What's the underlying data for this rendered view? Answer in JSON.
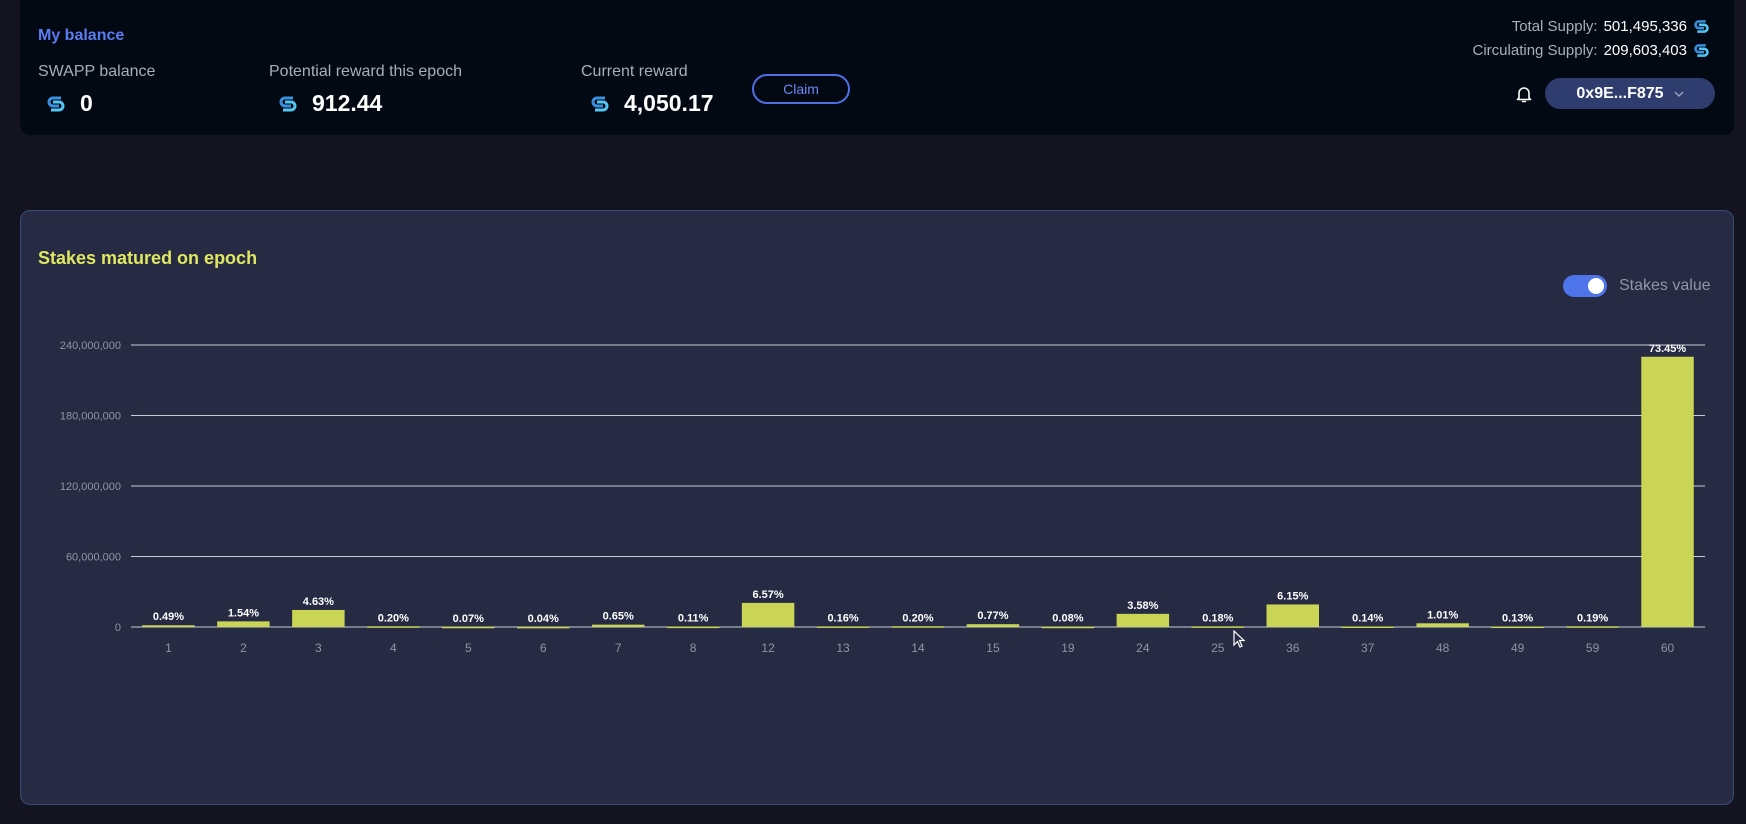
{
  "header": {
    "my_balance": "My balance",
    "swapp_balance": {
      "label": "SWAPP balance",
      "value": "0"
    },
    "potential_reward": {
      "label": "Potential reward this epoch",
      "value": "912.44"
    },
    "current_reward": {
      "label": "Current reward",
      "value": "4,050.17"
    },
    "claim_label": "Claim",
    "total_supply": {
      "label": "Total Supply:",
      "value": "501,495,336"
    },
    "circulating_supply": {
      "label": "Circulating Supply:",
      "value": "209,603,403"
    },
    "wallet_address": "0x9E...F875",
    "icons": {
      "coin": "swapp-coin-icon",
      "bell": "bell-icon",
      "chevron": "chevron-down-icon"
    }
  },
  "chart_card": {
    "title": "Stakes matured on epoch",
    "toggle_label": "Stakes value",
    "toggle_on": true
  },
  "colors": {
    "accent": "#4d74e8",
    "bar": "#cad556",
    "title": "#e0e760"
  },
  "chart_data": {
    "type": "bar",
    "title": "Stakes matured on epoch",
    "xlabel": "",
    "ylabel": "",
    "ylim": [
      0,
      240000000
    ],
    "yticks": [
      0,
      60000000,
      120000000,
      180000000,
      240000000
    ],
    "ytick_labels": [
      "0",
      "60,000,000",
      "120,000,000",
      "180,000,000",
      "240,000,000"
    ],
    "grid": true,
    "categories": [
      "1",
      "2",
      "3",
      "4",
      "5",
      "6",
      "7",
      "8",
      "12",
      "13",
      "14",
      "15",
      "19",
      "24",
      "25",
      "36",
      "37",
      "48",
      "49",
      "59",
      "60"
    ],
    "values": [
      1500000,
      4800000,
      14500000,
      600000,
      200000,
      130000,
      2000000,
      350000,
      20500000,
      500000,
      620000,
      2400000,
      250000,
      11200000,
      560000,
      19200000,
      440000,
      3150000,
      410000,
      600000,
      230000000
    ],
    "data_labels": [
      "0.49%",
      "1.54%",
      "4.63%",
      "0.20%",
      "0.07%",
      "0.04%",
      "0.65%",
      "0.11%",
      "6.57%",
      "0.16%",
      "0.20%",
      "0.77%",
      "0.08%",
      "3.58%",
      "0.18%",
      "6.15%",
      "0.14%",
      "1.01%",
      "0.13%",
      "0.19%",
      "73.45%"
    ]
  }
}
